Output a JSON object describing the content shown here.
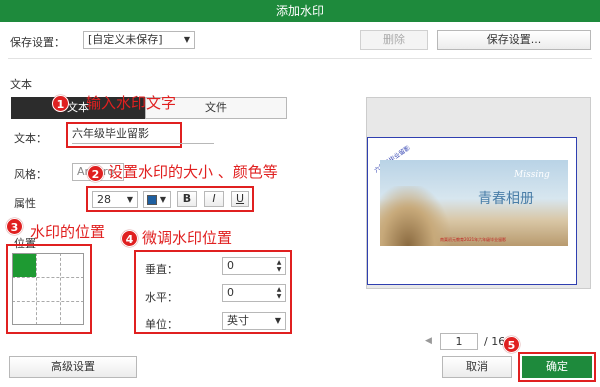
{
  "window": {
    "title": "添加水印"
  },
  "save": {
    "label": "保存设置：",
    "value": "[自定义未保存]",
    "delete_label": "删除",
    "save_button": "保存设置..."
  },
  "text_section": {
    "header": "文本",
    "tabs": [
      "文本",
      "文件"
    ],
    "text_label": "文本：",
    "text_value": "六年级毕业留影",
    "style_label": "风格：",
    "style_value": "Ari Aro",
    "attr_label": "属性",
    "font_size": "28",
    "bold": "B",
    "italic": "I",
    "underline": "U",
    "color_swatch": "#1f5fa0"
  },
  "position": {
    "label": "位置",
    "vertical_label": "垂直：",
    "vertical_value": "0",
    "horizontal_label": "水平：",
    "horizontal_value": "0",
    "unit_label": "单位：",
    "unit_value": "英寸"
  },
  "annotations": [
    {
      "num": "1",
      "text": "输入水印文字"
    },
    {
      "num": "2",
      "text": "设置水印的大小 、颜色等"
    },
    {
      "num": "3",
      "text": "水印的位置"
    },
    {
      "num": "4",
      "text": "微调水印位置"
    },
    {
      "num": "5",
      "text": ""
    }
  ],
  "preview": {
    "watermark_text": "六年级毕业留影",
    "banner_title": "青春相册",
    "banner_script": "Missing",
    "banner_footer": "南栗初元教育2021年六年级毕业留影",
    "page_current": "1",
    "page_total": "/ 16"
  },
  "footer": {
    "advanced": "高级设置",
    "cancel": "取消",
    "ok": "确定"
  },
  "colors": {
    "title_bar": "#1e8a3c",
    "ok_button": "#1e8a3c",
    "annotation": "#e02020",
    "grid_active": "#1e9a32"
  }
}
